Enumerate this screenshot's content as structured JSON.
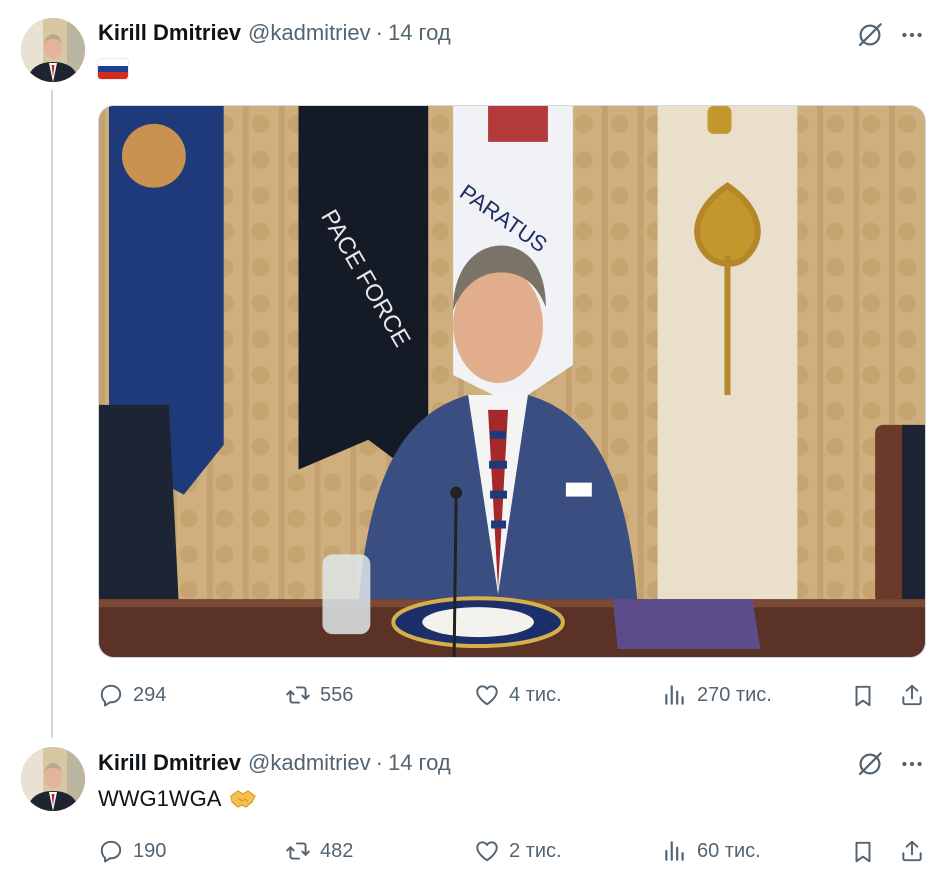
{
  "posts": [
    {
      "author_name": "Kirill Dmitriev",
      "author_handle": "@kadmitriev",
      "separator": "·",
      "time": "14 год",
      "flag_icon": "russian-flag",
      "has_photo": true,
      "stats": {
        "replies": "294",
        "reposts": "556",
        "likes": "4 тис.",
        "views": "270 тис."
      }
    },
    {
      "author_name": "Kirill Dmitriev",
      "author_handle": "@kadmitriev",
      "separator": "·",
      "time": "14 год",
      "text": "WWG1WGA",
      "text_emoji_icon": "handshake-icon",
      "stats": {
        "replies": "190",
        "reposts": "482",
        "likes": "2 тис.",
        "views": "60 тис."
      }
    }
  ],
  "icons": {
    "reply": "reply-icon",
    "repost": "repost-icon",
    "like": "like-icon",
    "views": "views-icon",
    "bookmark": "bookmark-icon",
    "share": "share-icon",
    "grok": "grok-icon",
    "more": "more-icon"
  },
  "colors": {
    "text_primary": "#0f1419",
    "text_secondary": "#536471",
    "thread_line": "#cfd9de",
    "flag_white": "#ffffff",
    "flag_blue": "#1c3f94",
    "flag_red": "#d52b1e"
  }
}
